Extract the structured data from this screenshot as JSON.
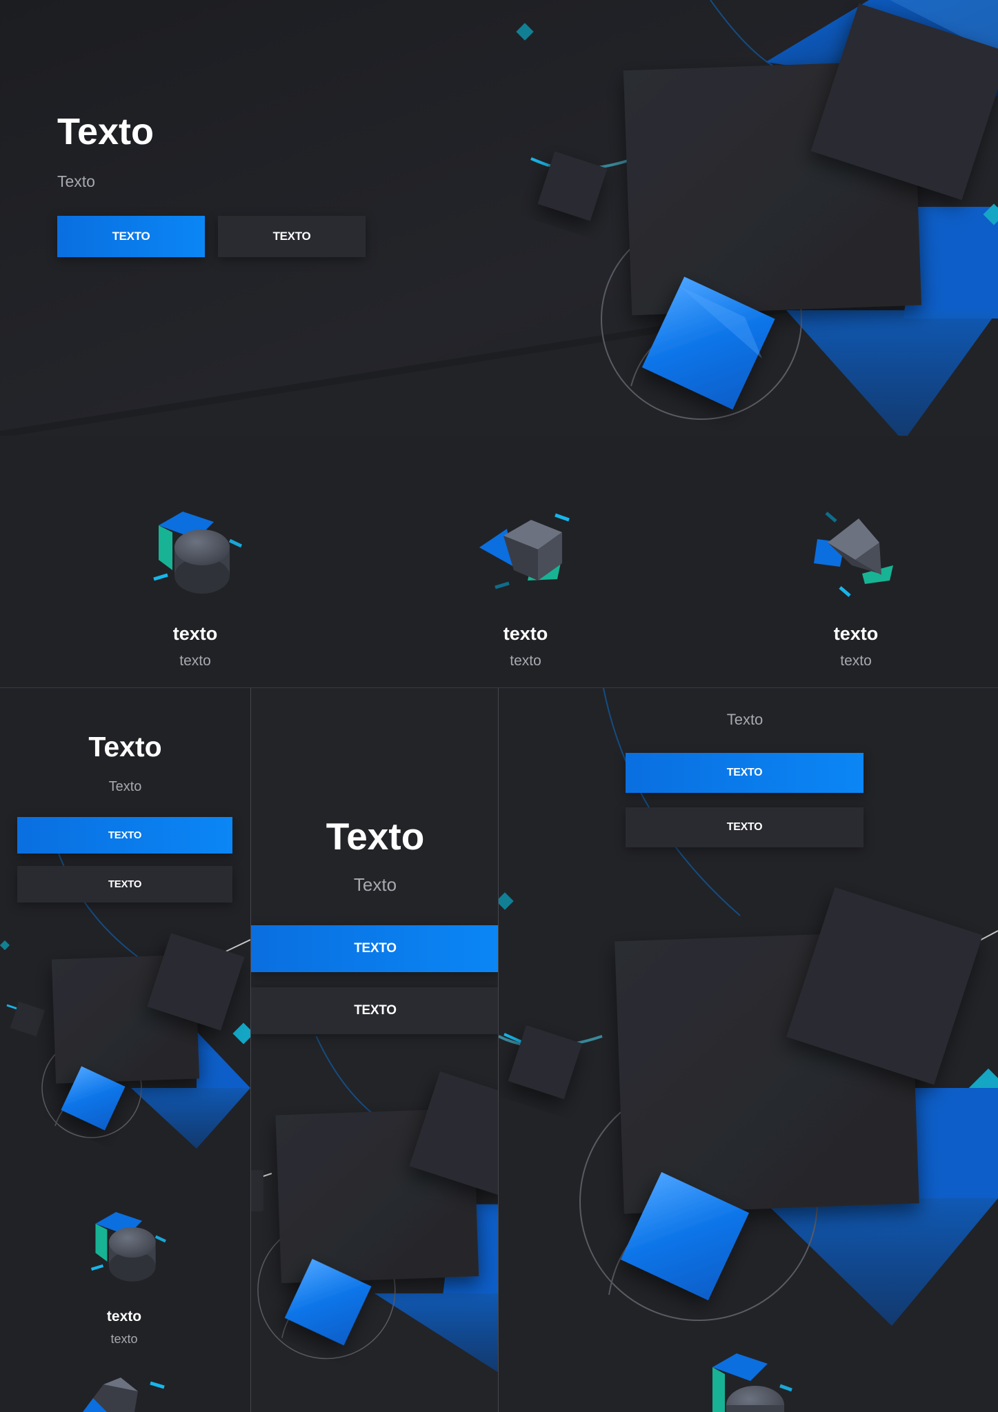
{
  "hero": {
    "title": "Texto",
    "subtitle": "Texto",
    "primary_button": "TEXTO",
    "secondary_button": "TEXTO"
  },
  "features": [
    {
      "title": "texto",
      "subtitle": "texto",
      "icon": "cylinder-icon"
    },
    {
      "title": "texto",
      "subtitle": "texto",
      "icon": "cube-icon"
    },
    {
      "title": "texto",
      "subtitle": "texto",
      "icon": "pyramid-icon"
    }
  ],
  "mobile_small": {
    "title": "Texto",
    "subtitle": "Texto",
    "primary_button": "TEXTO",
    "secondary_button": "TEXTO",
    "feature_title": "texto",
    "feature_subtitle": "texto"
  },
  "mobile_mid": {
    "title": "Texto",
    "subtitle": "Texto",
    "primary_button": "TEXTO",
    "secondary_button": "TEXTO"
  },
  "tablet": {
    "subtitle": "Texto",
    "primary_button": "TEXTO",
    "secondary_button": "TEXTO"
  },
  "colors": {
    "background": "#1f2024",
    "accent": "#0b7ff0",
    "teal": "#18b5a0",
    "panel": "#2a2b30"
  }
}
